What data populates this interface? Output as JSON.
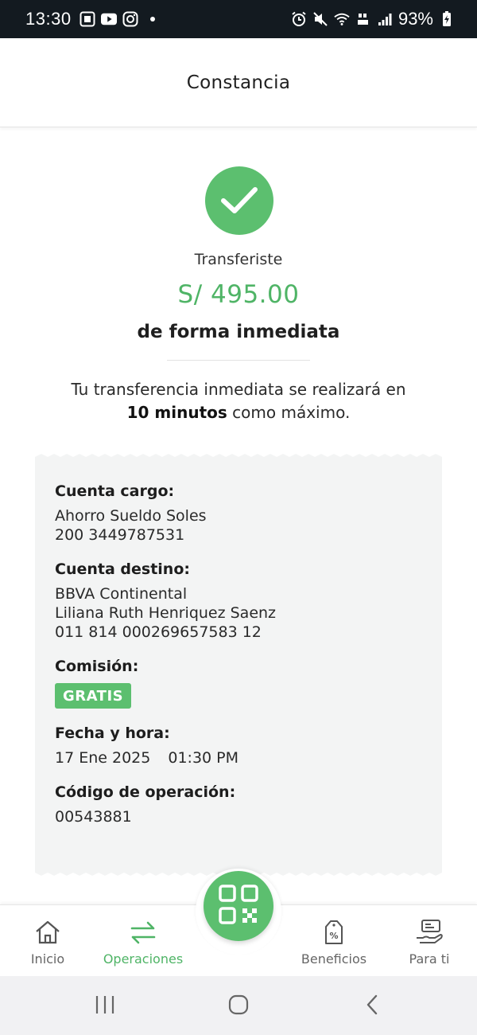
{
  "status_bar": {
    "time": "13:30",
    "battery": "93%"
  },
  "header": {
    "title": "Constancia"
  },
  "result": {
    "intro": "Transferiste",
    "amount": "S/ 495.00",
    "mode": "de forma inmediata",
    "description_line1": "Tu transferencia inmediata se realizará en",
    "description_bold": "10 minutos",
    "description_rest": "como máximo."
  },
  "receipt": {
    "cuenta_cargo": {
      "label": "Cuenta cargo:",
      "account_name": "Ahorro Sueldo Soles",
      "account_number": "200 3449787531"
    },
    "cuenta_destino": {
      "label": "Cuenta destino:",
      "bank": "BBVA Continental",
      "holder": "Liliana Ruth Henriquez Saenz",
      "account_number": "011 814 000269657583 12"
    },
    "comision": {
      "label": "Comisión:",
      "value": "GRATIS"
    },
    "fecha_hora": {
      "label": "Fecha y hora:",
      "date": "17 Ene 2025",
      "time": "01:30 PM"
    },
    "codigo": {
      "label": "Código de operación:",
      "value": "00543881"
    }
  },
  "bottom_nav": {
    "items": [
      {
        "label": "Inicio",
        "icon": "home-icon"
      },
      {
        "label": "Operaciones",
        "icon": "transfer-arrows-icon",
        "active": true
      },
      {
        "label": "Beneficios",
        "icon": "discount-tag-icon"
      },
      {
        "label": "Para ti",
        "icon": "hand-card-icon"
      }
    ],
    "fab_icon": "qr-code-icon"
  },
  "colors": {
    "accent_green": "#5cbf6f",
    "amount_green": "#4fb466",
    "status_bar_bg": "#131a20",
    "receipt_bg": "#f3f4f4"
  }
}
